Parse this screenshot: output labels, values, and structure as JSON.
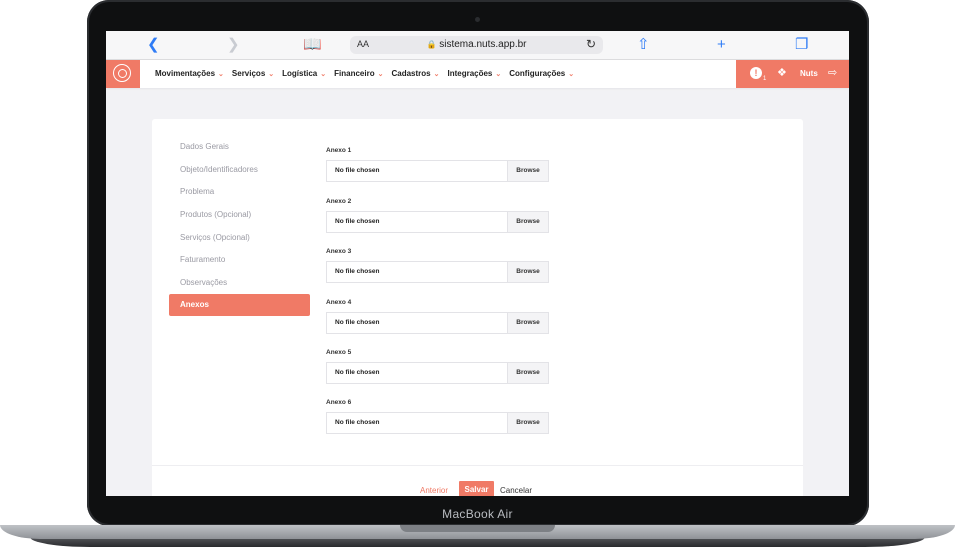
{
  "device": {
    "label": "MacBook Air"
  },
  "browser": {
    "url_aa": "AA",
    "url": "sistema.nuts.app.br",
    "icons": [
      "back-icon",
      "forward-icon",
      "bookmarks-icon",
      "lock-icon",
      "reload-icon",
      "share-icon",
      "new-tab-icon",
      "tabs-icon"
    ]
  },
  "navbar": {
    "menu": [
      {
        "label": "Movimentações"
      },
      {
        "label": "Serviços"
      },
      {
        "label": "Logística"
      },
      {
        "label": "Financeiro"
      },
      {
        "label": "Cadastros"
      },
      {
        "label": "Integrações"
      },
      {
        "label": "Configurações"
      }
    ],
    "alert_count": "1",
    "user": "Nuts",
    "accent": "#f07a66"
  },
  "sidebar": {
    "items": [
      {
        "label": "Dados Gerais"
      },
      {
        "label": "Objeto/Identificadores"
      },
      {
        "label": "Problema"
      },
      {
        "label": "Produtos (Opcional)"
      },
      {
        "label": "Serviços (Opcional)"
      },
      {
        "label": "Faturamento"
      },
      {
        "label": "Observações"
      },
      {
        "label": "Anexos"
      }
    ],
    "active": "Anexos"
  },
  "attachments": [
    {
      "label": "Anexo 1",
      "value": "No file chosen",
      "button": "Browse"
    },
    {
      "label": "Anexo 2",
      "value": "No file chosen",
      "button": "Browse"
    },
    {
      "label": "Anexo 3",
      "value": "No file chosen",
      "button": "Browse"
    },
    {
      "label": "Anexo 4",
      "value": "No file chosen",
      "button": "Browse"
    },
    {
      "label": "Anexo 5",
      "value": "No file chosen",
      "button": "Browse"
    },
    {
      "label": "Anexo 6",
      "value": "No file chosen",
      "button": "Browse"
    }
  ],
  "footer": {
    "anterior": "Anterior",
    "salvar": "Salvar",
    "cancelar": "Cancelar"
  }
}
